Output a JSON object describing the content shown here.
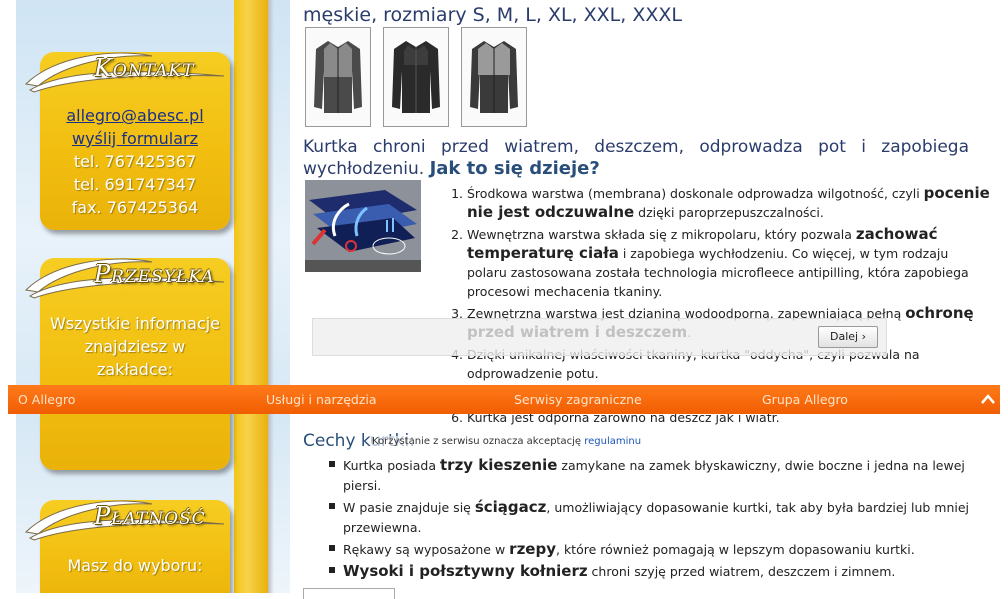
{
  "sidebar": {
    "kontakt": {
      "heading": "Kontakt",
      "email": "allegro@abesc.pl",
      "form_link": "wyślij formularz",
      "phone1": "tel. 767425367",
      "phone2": "tel. 691747347",
      "fax": "fax. 767425364"
    },
    "przesylka": {
      "heading": "Przesyłka",
      "line1": "Wszystkie informacje",
      "line2": "znajdziesz w",
      "line3": "zakładce:"
    },
    "platnosc": {
      "heading": "Płatność",
      "line1": "Masz do wyboru:"
    }
  },
  "main": {
    "title_line": "męskie, rozmiary S, M, L, XL, XXL, XXXL",
    "thumbnails": [
      "jacket-front-icon",
      "jacket-black-icon",
      "jacket-grey-icon"
    ],
    "intro_text": "Kurtka chroni przed wiatrem, deszczem, odprowadza pot i zapobiega wychłodzeniu.",
    "intro_question": "Jak to się dzieje?",
    "numbered_list": [
      {
        "pre": "Środkowa warstwa (membrana) doskonale odprowadza wilgotność, czyli ",
        "bold": "pocenie nie jest odczuwalne",
        "post": " dzięki paroprzepuszczalności."
      },
      {
        "pre": "Wewnętrzna warstwa składa się z mikropolaru, który pozwala ",
        "bold": "zachować temperaturę ciała",
        "post": " i zapobiega wychłodzeniu. Co więcej, w tym rodzaju polaru zastosowana została technologia microfleece antipilling, która zapobiega procesowi mechacenia tkaniny."
      },
      {
        "pre": "Zewnętrzna warstwa jest dzianiną wodoodporną, zapewniającą pełną ",
        "bold": "ochronę przed wiatrem i deszczem",
        "post": "."
      },
      {
        "pre": "Dzięki unikalnej właściwości tkaniny, kurtka \"oddycha\", czyli pozwala na odprowadzenie potu.",
        "bold": "",
        "post": ""
      },
      {
        "pre": "",
        "bold": "",
        "post": ""
      },
      {
        "pre": "Kurtka jest odporna zarówno na deszcz jak i wiatr.",
        "bold": "",
        "post": ""
      }
    ],
    "features_title": "Cechy kurtki:",
    "features": [
      {
        "pre": "Kurtka posiada ",
        "bold": "trzy kieszenie",
        "post": " zamykane na zamek błyskawiczny, dwie boczne i jedna na lewej piersi."
      },
      {
        "pre": "W pasie znajduje się ",
        "bold": "ściągacz",
        "post": ", umożliwiający dopasowanie kurtki, tak aby była bardziej lub mniej przewiewna."
      },
      {
        "pre": "Rękawy są wyposażone w ",
        "bold": "rzepy",
        "post": ", które również pomagają w lepszym dopasowaniu kurtki."
      },
      {
        "pre": "",
        "bold": "Wysoki i połsztywny kołnierz",
        "post": " chroni szyję przed wiatrem, deszczem i zimnem."
      }
    ]
  },
  "overlay": {
    "next_button": "Dalej ›",
    "bar_items": [
      "O Allegro",
      "Usługi i narzędzia",
      "Serwisy zagraniczne",
      "Grupa Allegro"
    ],
    "cookie_text": "Korzystanie z serwisu oznacza akceptację ",
    "cookie_link": "regulaminu"
  },
  "colors": {
    "gold": "#f1bd0f",
    "orange_bar": "#f56a0a",
    "heading_blue": "#2a3c6b",
    "link_blue": "#1a2f8a"
  }
}
